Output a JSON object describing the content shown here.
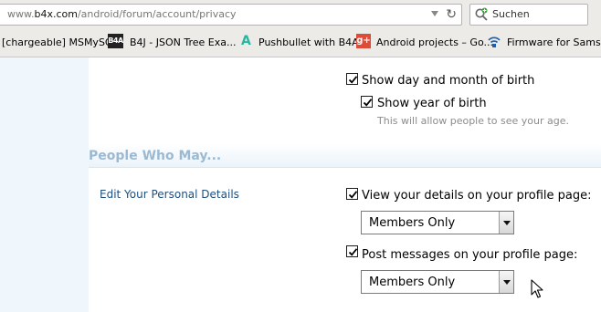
{
  "browser": {
    "url_prefix": "www.",
    "url_host": "b4x.com",
    "url_path": "/android/forum/account/privacy",
    "search_placeholder": "Suchen",
    "bookmarks": [
      {
        "label": "[chargeable] MSMySQL",
        "icon": "none"
      },
      {
        "label": "B4J - JSON Tree Exa...",
        "icon": "b4a-logo-icon",
        "icon_text": "B4A"
      },
      {
        "label": "Pushbullet with B4A?",
        "icon": "pushbullet-icon",
        "icon_text": "A"
      },
      {
        "label": "Android projects – Go...",
        "icon": "google-plus-icon",
        "icon_text": "g+"
      },
      {
        "label": "Firmware for Samsun",
        "icon": "wifi-icon"
      }
    ]
  },
  "privacy": {
    "show_day_month": {
      "label": "Show day and month of birth",
      "checked": true
    },
    "show_year": {
      "label": "Show year of birth",
      "checked": true,
      "hint": "This will allow people to see your age."
    },
    "section_title": "People Who May...",
    "edit_link": "Edit Your Personal Details",
    "view_details": {
      "label": "View your details on your profile page:",
      "checked": true,
      "selected": "Members Only"
    },
    "post_messages": {
      "label": "Post messages on your profile page:",
      "checked": true,
      "selected": "Members Only"
    }
  },
  "colors": {
    "page_background": "#f0f7fc",
    "section_title": "#9bbad2",
    "link": "#1f4f7f",
    "hint_text": "#8c8c8c"
  }
}
